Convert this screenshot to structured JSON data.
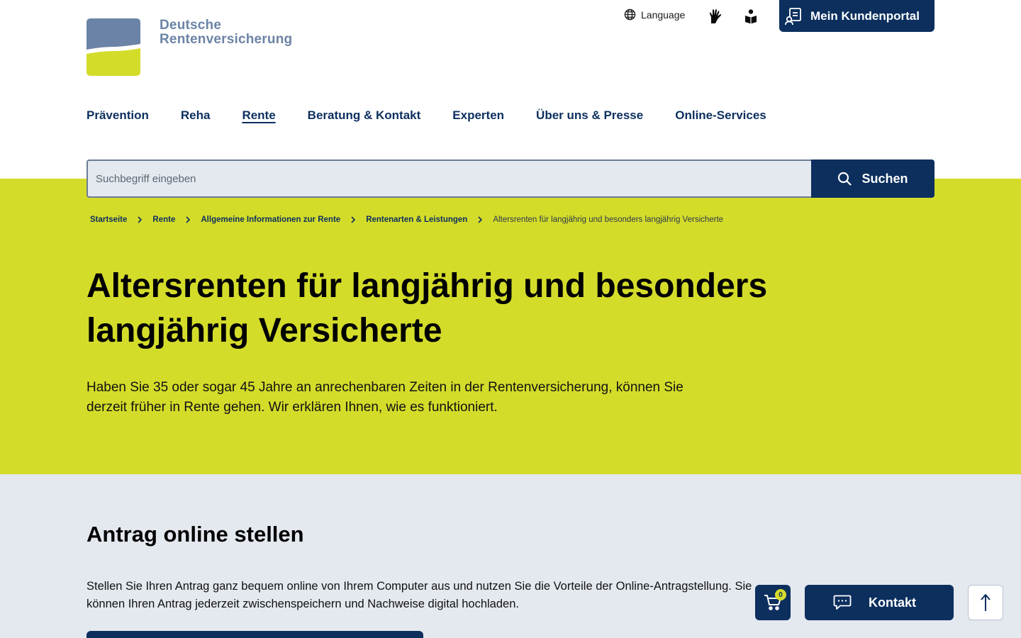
{
  "brand": {
    "line1": "Deutsche",
    "line2": "Rentenversicherung",
    "colors": {
      "primary": "#0c2f5e",
      "logo_blue": "#6b83a6",
      "accent": "#d4dc2a",
      "section_bg": "#e4e9f0"
    }
  },
  "meta": {
    "language_label": "Language",
    "icons": [
      "globe-icon",
      "sign-language-icon",
      "easy-language-icon"
    ],
    "portal_label": "Mein Kundenportal"
  },
  "nav": {
    "items": [
      {
        "label": "Prävention"
      },
      {
        "label": "Reha"
      },
      {
        "label": "Rente",
        "active": true
      },
      {
        "label": "Beratung & Kontakt"
      },
      {
        "label": "Experten"
      },
      {
        "label": "Über uns & Presse"
      },
      {
        "label": "Online-Services"
      }
    ]
  },
  "search": {
    "placeholder": "Suchbegriff eingeben",
    "button_label": "Suchen"
  },
  "breadcrumb": {
    "items": [
      "Startseite",
      "Rente",
      "Allgemeine Informationen zur Rente",
      "Rentenarten & Leistungen"
    ],
    "current": "Altersrenten für langjährig und besonders langjährig Versicherte"
  },
  "hero": {
    "title": "Altersrenten für langjährig und besonders langjährig Versicherte",
    "intro": "Haben Sie 35 oder sogar 45 Jahre an anrechenbaren Zeiten in der Rentenversicherung, können Sie derzeit früher in Rente gehen. Wir erklären Ihnen, wie es funktioniert."
  },
  "section": {
    "title": "Antrag online stellen",
    "text": "Stellen Sie Ihren Antrag ganz bequem online von Ihrem Computer aus und nutzen Sie die Vorteile der Online-Antragstellung. Sie können Ihren Antrag jederzeit zwischenspeichern und Nachweise digital hochladen."
  },
  "floating": {
    "cart_count": "0",
    "kontakt_label": "Kontakt"
  }
}
